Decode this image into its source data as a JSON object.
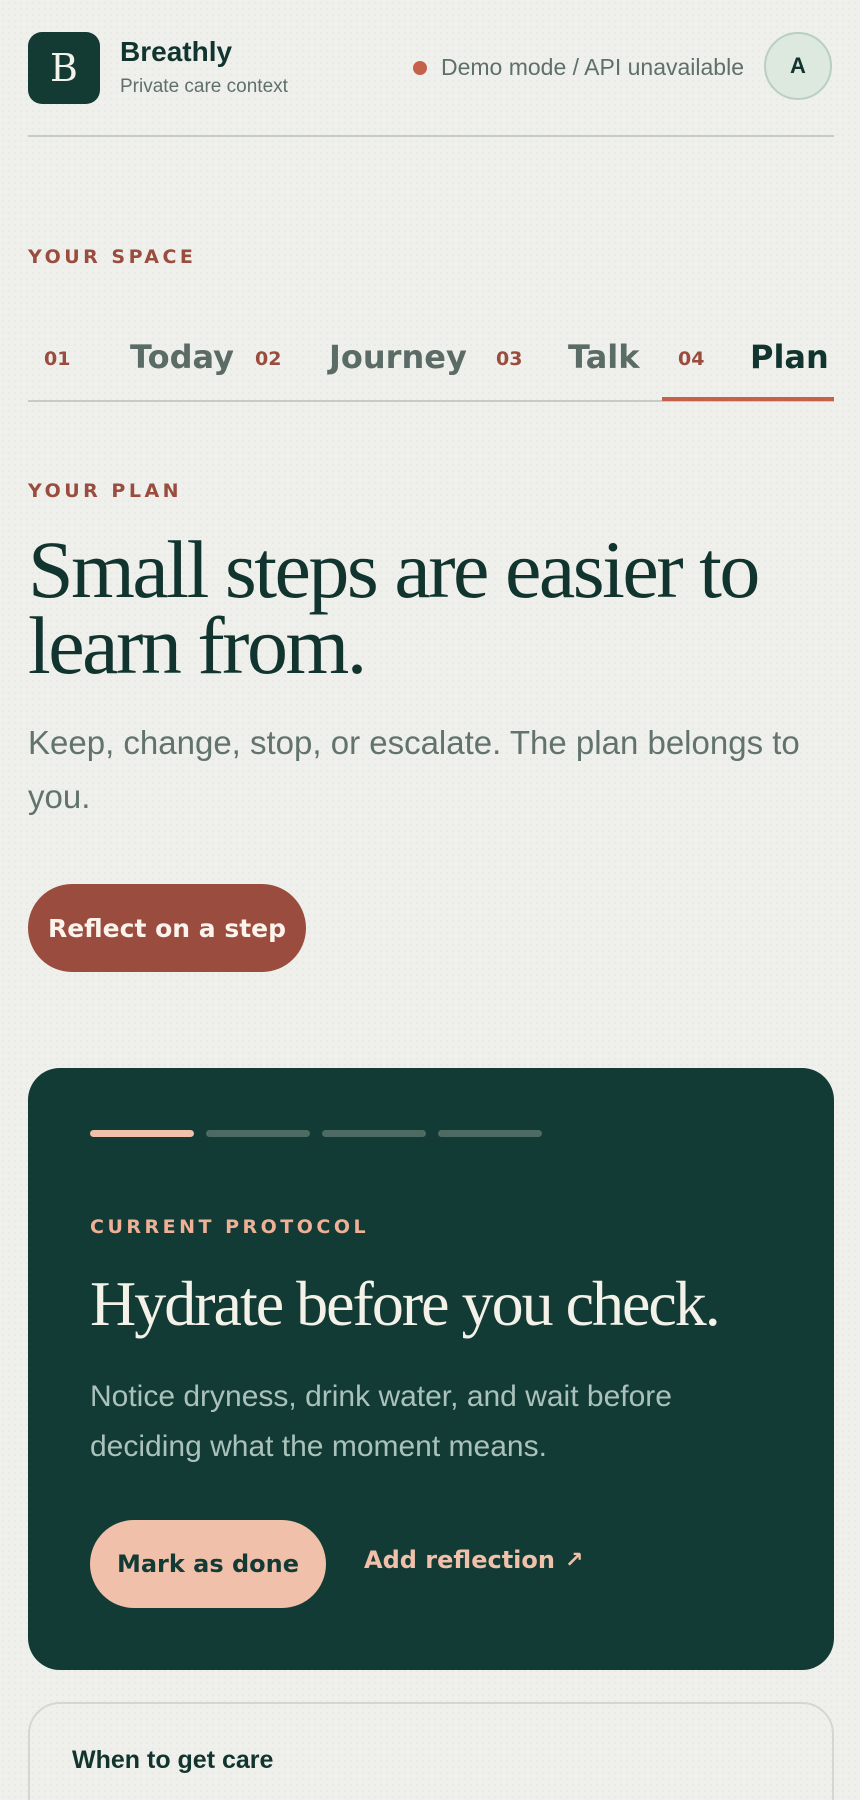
{
  "header": {
    "logo_letter": "B",
    "brand_name": "Breathly",
    "brand_subtitle": "Private care context",
    "status_text": "Demo mode / API unavailable",
    "avatar_initial": "A"
  },
  "space": {
    "eyebrow": "YOUR SPACE"
  },
  "tabs": [
    {
      "num": "01",
      "label": "Today"
    },
    {
      "num": "02",
      "label": "Journey"
    },
    {
      "num": "03",
      "label": "Talk"
    },
    {
      "num": "04",
      "label": "Plan",
      "active": true
    }
  ],
  "hero": {
    "eyebrow": "YOUR PLAN",
    "title_line1": "Small steps are easier to",
    "title_line2": "learn from.",
    "subtitle": "Keep, change, stop, or escalate. The plan belongs to you.",
    "button_label": "Reflect on a step"
  },
  "protocol": {
    "progress_segments": 4,
    "progress_completed": 1,
    "eyebrow": "CURRENT PROTOCOL",
    "title": "Hydrate before you check.",
    "body": "Notice dryness, drink water, and wait before deciding what the moment means.",
    "done_label": "Mark as done",
    "reflection_label": "Add reflection",
    "reflection_icon": "↗"
  },
  "care": {
    "title": "When to get care"
  },
  "colors": {
    "background": "#eff0eb",
    "brand_dark": "#143a34",
    "accent": "#c4604b",
    "accent_dark": "#9a4c3e",
    "peach": "#f0c0aa"
  }
}
